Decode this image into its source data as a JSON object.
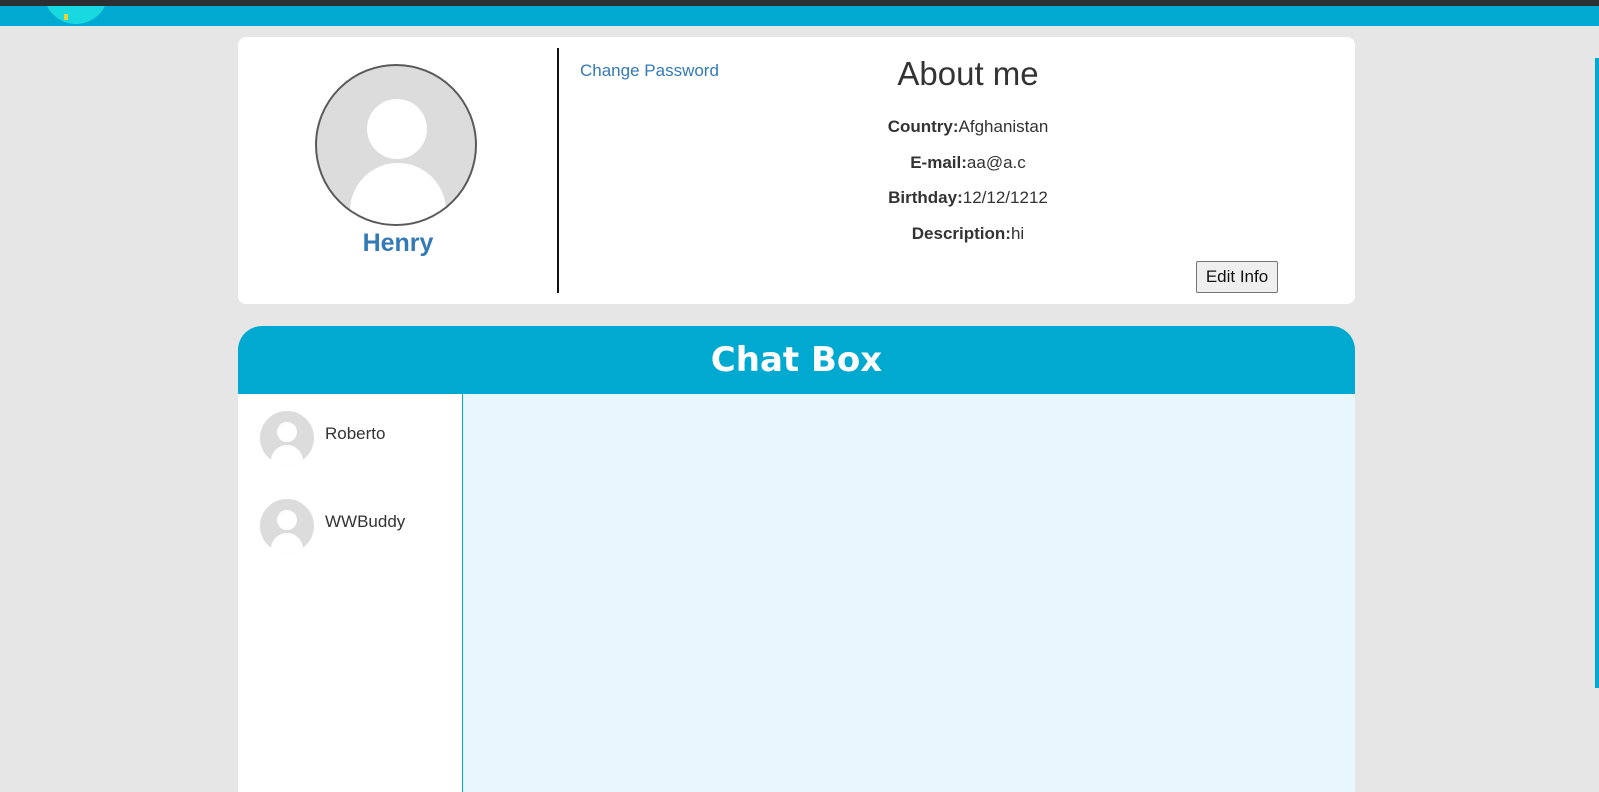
{
  "profile": {
    "username": "Henry",
    "change_password_label": "Change Password",
    "about_title": "About me",
    "fields": [
      {
        "label": "Country:",
        "value": "Afghanistan"
      },
      {
        "label": "E-mail:",
        "value": "aa@a.c"
      },
      {
        "label": "Birthday:",
        "value": "12/12/1212"
      },
      {
        "label": "Description:",
        "value": "hi"
      }
    ],
    "edit_label": "Edit Info"
  },
  "chat": {
    "title": "Chat Box",
    "contacts": [
      {
        "name": "Roberto"
      },
      {
        "name": "WWBuddy"
      }
    ]
  },
  "colors": {
    "accent": "#00a9d0",
    "link": "#337ab7",
    "page_background": "#e6e6e6",
    "message_area": "#e8f7fd"
  }
}
